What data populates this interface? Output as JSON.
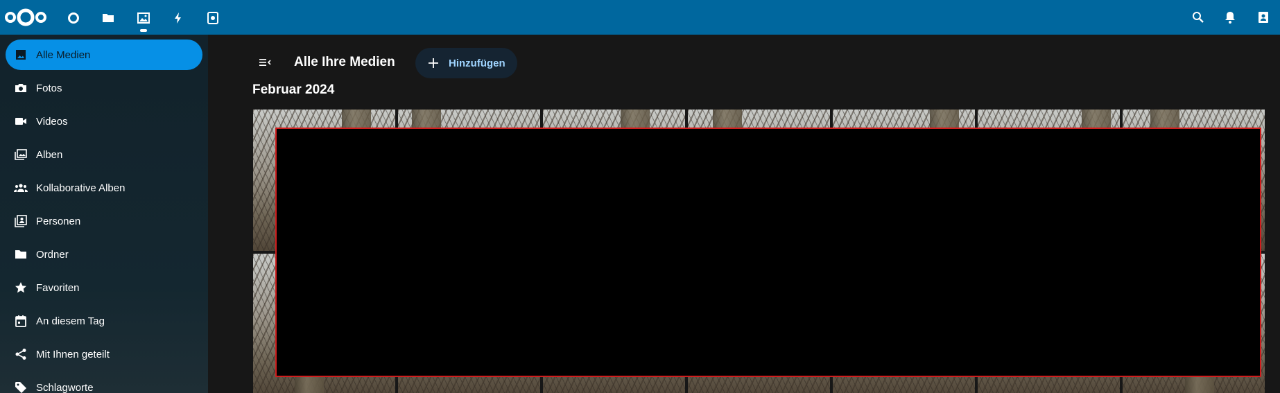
{
  "header": {
    "logo_name": "nextcloud-logo",
    "apps": [
      {
        "name": "dashboard-icon",
        "active": false
      },
      {
        "name": "files-icon",
        "active": false
      },
      {
        "name": "photos-icon",
        "active": true
      },
      {
        "name": "activity-icon",
        "active": false
      },
      {
        "name": "memories-icon",
        "active": false
      }
    ],
    "right_icons": [
      "search-icon",
      "notifications-icon",
      "contacts-icon"
    ],
    "background": "#00679e"
  },
  "sidebar": {
    "items": [
      {
        "label": "Alle Medien",
        "icon": "image-icon",
        "active": true
      },
      {
        "label": "Fotos",
        "icon": "camera-icon",
        "active": false
      },
      {
        "label": "Videos",
        "icon": "video-icon",
        "active": false
      },
      {
        "label": "Alben",
        "icon": "albums-icon",
        "active": false
      },
      {
        "label": "Kollaborative Alben",
        "icon": "collaborative-albums-icon",
        "active": false
      },
      {
        "label": "Personen",
        "icon": "people-icon",
        "active": false
      },
      {
        "label": "Ordner",
        "icon": "folder-icon",
        "active": false
      },
      {
        "label": "Favoriten",
        "icon": "star-icon",
        "active": false
      },
      {
        "label": "An diesem Tag",
        "icon": "calendar-icon",
        "active": false
      },
      {
        "label": "Mit Ihnen geteilt",
        "icon": "share-icon",
        "active": false
      },
      {
        "label": "Schlagworte",
        "icon": "tag-icon",
        "active": false
      }
    ],
    "accent": "#0690e6"
  },
  "main": {
    "title": "Alle Ihre Medien",
    "add_button_label": "Hinzufügen",
    "sections": [
      {
        "heading": "Februar 2024"
      }
    ]
  },
  "overlay": {
    "border_color": "#d01d1d",
    "fill_color": "#000000"
  }
}
